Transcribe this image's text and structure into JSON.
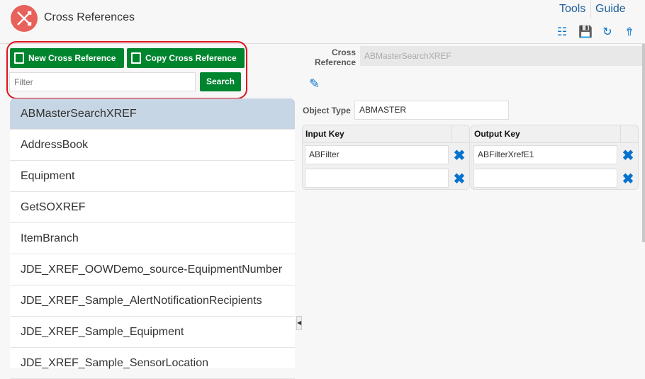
{
  "header": {
    "title": "Cross References",
    "tools": "Tools",
    "guide": "Guide"
  },
  "toolbar": {
    "new_label": "New Cross Reference",
    "copy_label": "Copy Cross Reference",
    "filter_placeholder": "Filter",
    "search_label": "Search"
  },
  "list": [
    "ABMasterSearchXREF",
    "AddressBook",
    "Equipment",
    "GetSOXREF",
    "ItemBranch",
    "JDE_XREF_OOWDemo_source-EquipmentNumber",
    "JDE_XREF_Sample_AlertNotificationRecipients",
    "JDE_XREF_Sample_Equipment",
    "JDE_XREF_Sample_SensorLocation"
  ],
  "detail": {
    "xref_label": "Cross Reference",
    "xref_value": "ABMasterSearchXREF",
    "object_type_label": "Object Type",
    "object_type_value": "ABMASTER",
    "input_header": "Input Key",
    "output_header": "Output Key",
    "input_rows": [
      "ABFilter",
      ""
    ],
    "output_rows": [
      "ABFilterXrefE1",
      ""
    ]
  }
}
